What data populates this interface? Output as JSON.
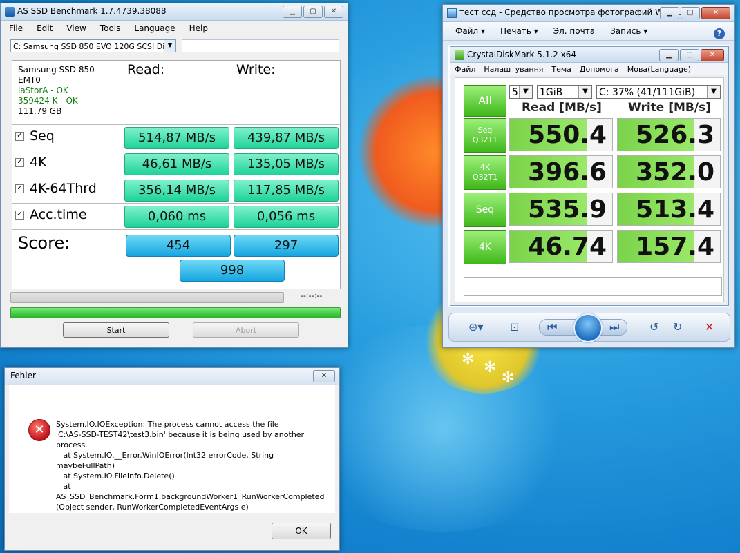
{
  "asssd": {
    "title": "AS SSD Benchmark 1.7.4739.38088",
    "menu": [
      "File",
      "Edit",
      "View",
      "Tools",
      "Language",
      "Help"
    ],
    "drive_select": "C: Samsung SSD 850 EVO 120G SCSI Disk D",
    "info": {
      "model": "Samsung SSD 850",
      "firmware": "EMT0",
      "driver": "iaStorA - OK",
      "alignment": "359424 K - OK",
      "size": "111,79 GB"
    },
    "headers": {
      "read": "Read:",
      "write": "Write:"
    },
    "rows": [
      {
        "label": "Seq",
        "checked": "✓",
        "read": "514,87 MB/s",
        "write": "439,87 MB/s"
      },
      {
        "label": "4K",
        "checked": "✓",
        "read": "46,61 MB/s",
        "write": "135,05 MB/s"
      },
      {
        "label": "4K-64Thrd",
        "checked": "✓",
        "read": "356,14 MB/s",
        "write": "117,85 MB/s"
      },
      {
        "label": "Acc.time",
        "checked": "✓",
        "read": "0,060 ms",
        "write": "0,056 ms"
      }
    ],
    "score": {
      "label": "Score:",
      "read": "454",
      "write": "297",
      "total": "998"
    },
    "timer": "--:--:--",
    "buttons": {
      "start": "Start",
      "abort": "Abort"
    },
    "progress": {
      "top": 0,
      "bottom": 1.0
    }
  },
  "viewer": {
    "title": "тест ссд - Средство просмотра фотографий Wind...",
    "menu": [
      "Файл ▾",
      "Печать ▾",
      "Эл. почта",
      "Запись ▾"
    ],
    "help": "?"
  },
  "cdm": {
    "title": "CrystalDiskMark 5.1.2 x64",
    "menu": [
      "Файл",
      "Налаштування",
      "Тема",
      "Допомога",
      "Мова(Language)"
    ],
    "all_label": "All",
    "count": "5",
    "size": "1GiB",
    "drive": "C: 37% (41/111GiB)",
    "headers": {
      "read": "Read [MB/s]",
      "write": "Write [MB/s]"
    },
    "rows": [
      {
        "label1": "Seq",
        "label2": "Q32T1",
        "read": "550.4",
        "write": "526.3",
        "read_fill": 0.75,
        "write_fill": 0.75
      },
      {
        "label1": "4K",
        "label2": "Q32T1",
        "read": "396.6",
        "write": "352.0",
        "read_fill": 0.75,
        "write_fill": 0.75
      },
      {
        "label1": "Seq",
        "label2": "",
        "read": "535.9",
        "write": "513.4",
        "read_fill": 0.75,
        "write_fill": 0.75
      },
      {
        "label1": "4K",
        "label2": "",
        "read": "46.74",
        "write": "157.4",
        "read_fill": 0.75,
        "write_fill": 0.75
      }
    ]
  },
  "error": {
    "title": "Fehler",
    "message": "System.IO.IOException: The process cannot access the file\n'C:\\AS-SSD-TEST42\\test3.bin' because it is being used by another\nprocess.\n   at System.IO.__Error.WinIOError(Int32 errorCode, String\nmaybeFullPath)\n   at System.IO.FileInfo.Delete()\n   at\nAS_SSD_Benchmark.Form1.backgroundWorker1_RunWorkerCompleted\n(Object sender, RunWorkerCompletedEventArgs e)",
    "ok": "OK"
  },
  "colors": {
    "result_green": "#1ed39a",
    "score_blue": "#15a6e0",
    "cdm_green": "#3fb81a",
    "desktop_blue": "#1483cf"
  }
}
